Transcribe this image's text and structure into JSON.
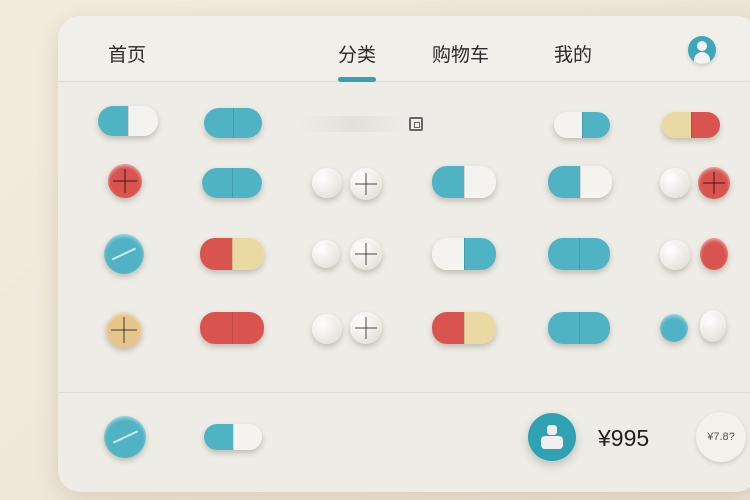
{
  "nav": {
    "home": "首页",
    "category": "分类",
    "cart": "购物车",
    "mine": "我的"
  },
  "icons": {
    "avatar": "user-icon",
    "scan": "scan-icon",
    "user_fab": "user-card-icon"
  },
  "footer": {
    "price": "¥995",
    "badge": "¥7.8?"
  },
  "colors": {
    "accent": "#3a9fb0",
    "teal": "#4fb3c4",
    "red": "#d9534f",
    "cream": "#ebd9a3"
  }
}
